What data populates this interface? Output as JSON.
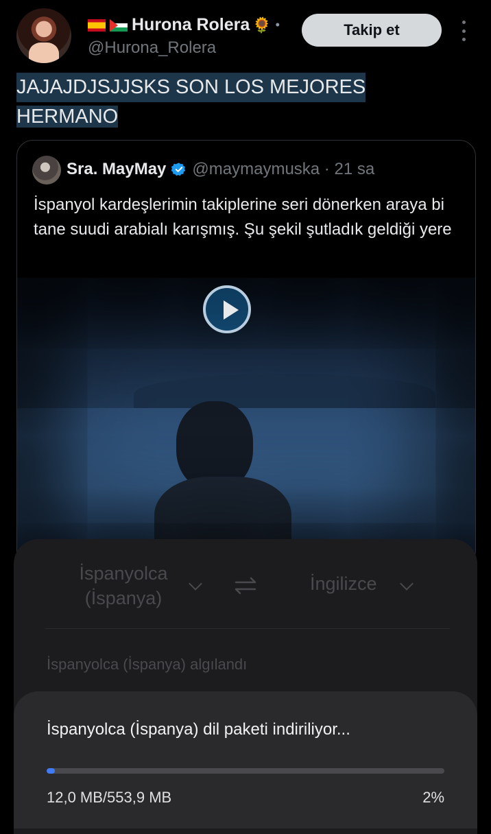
{
  "author": {
    "display_name": "Hurona Rolera",
    "flag_icons": [
      "spain-flag-icon",
      "palestine-flag-icon"
    ],
    "name_emoji": "🌻",
    "separator": "•",
    "handle": "@Hurona_Rolera",
    "follow_label": "Takip et",
    "more_icon": "more-vertical-icon"
  },
  "tweet": {
    "text_line1": "JAJAJDJSJJSKS SON LOS MEJORES",
    "text_line2": "HERMANO"
  },
  "quoted_tweet": {
    "display_name": "Sra. MayMay",
    "verified_icon": "verified-badge-icon",
    "handle_time": "@maymaymuska · 21 sa",
    "text": "İspanyol kardeşlerimin takiplerine seri dönerken araya bi tane suudi arabialı karışmış. Şu şekil şutladık geldiği yere",
    "video_play_icon": "play-icon"
  },
  "translate_sheet": {
    "source_language": "İspanyolca (İspanya)",
    "target_language": "İngilizce",
    "swap_icon": "swap-arrows-icon",
    "detected_text": "İspanyolca (İspanya) algılandı"
  },
  "download_dialog": {
    "title": "İspanyolca (İspanya) dil paketi indiriliyor...",
    "size_text": "12,0 MB/553,9 MB",
    "percent_text": "2%",
    "progress_fraction": 0.02
  },
  "colors": {
    "accent_blue": "#3e7bf5",
    "highlight": "#1d3649",
    "verified": "#1d9bf0"
  }
}
